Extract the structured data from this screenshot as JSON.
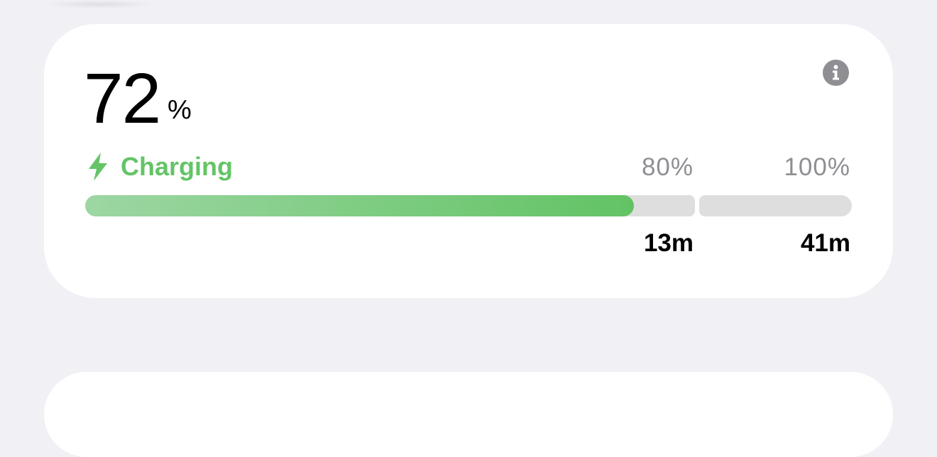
{
  "battery": {
    "level_number": "72",
    "level_unit": "%",
    "level_fraction": 0.72,
    "status_label": "Charging",
    "status_icon": "bolt-icon",
    "info_icon": "info-icon"
  },
  "milestones": [
    {
      "label": "80%",
      "eta": "13m"
    },
    {
      "label": "100%",
      "eta": "41m"
    }
  ],
  "colors": {
    "charging_green": "#64c466",
    "track_gray": "#dedede",
    "muted_text": "#8e8e93",
    "info_gray": "#8e8e93",
    "background": "#f1f0f5"
  }
}
